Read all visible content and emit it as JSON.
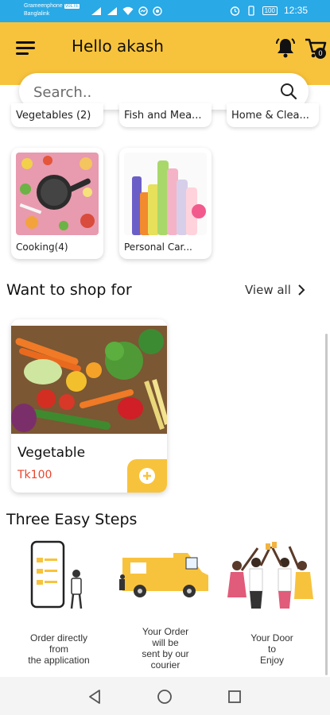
{
  "status_bar": {
    "carrier_1": "Grameenphone",
    "carrier_badge": "VoLTE",
    "carrier_2": "Banglalink",
    "battery": "100",
    "time": "12:35",
    "color": "#29a9e6"
  },
  "header": {
    "greeting": "Hello akash",
    "cart_count": "0",
    "color": "#f8c33c"
  },
  "search": {
    "placeholder": "Search.."
  },
  "categories_partial": [
    {
      "label": "Vegetables (2)"
    },
    {
      "label": "Fish and Mea..."
    },
    {
      "label": "Home & Clea..."
    }
  ],
  "categories": [
    {
      "label": "Cooking(4)",
      "icon": "cooking-image"
    },
    {
      "label": "Personal Car...",
      "icon": "personal-care-image"
    }
  ],
  "shop_section": {
    "title": "Want to shop for",
    "view_all": "View all"
  },
  "products": [
    {
      "name": "Vegetable",
      "price": "Tk100",
      "price_color": "#e8452c"
    }
  ],
  "steps_section": {
    "title": "Three Easy Steps",
    "steps": [
      {
        "line1": "Order directly",
        "line2": "from",
        "line3": "the application"
      },
      {
        "line1": "Your Order",
        "line2": "will be",
        "line3": "sent by our",
        "line4": "courier"
      },
      {
        "line1": "Your Door",
        "line2": "to",
        "line3": "Enjoy"
      }
    ]
  },
  "nav_bar": {
    "icons": [
      "back-icon",
      "home-icon",
      "recents-icon"
    ]
  }
}
